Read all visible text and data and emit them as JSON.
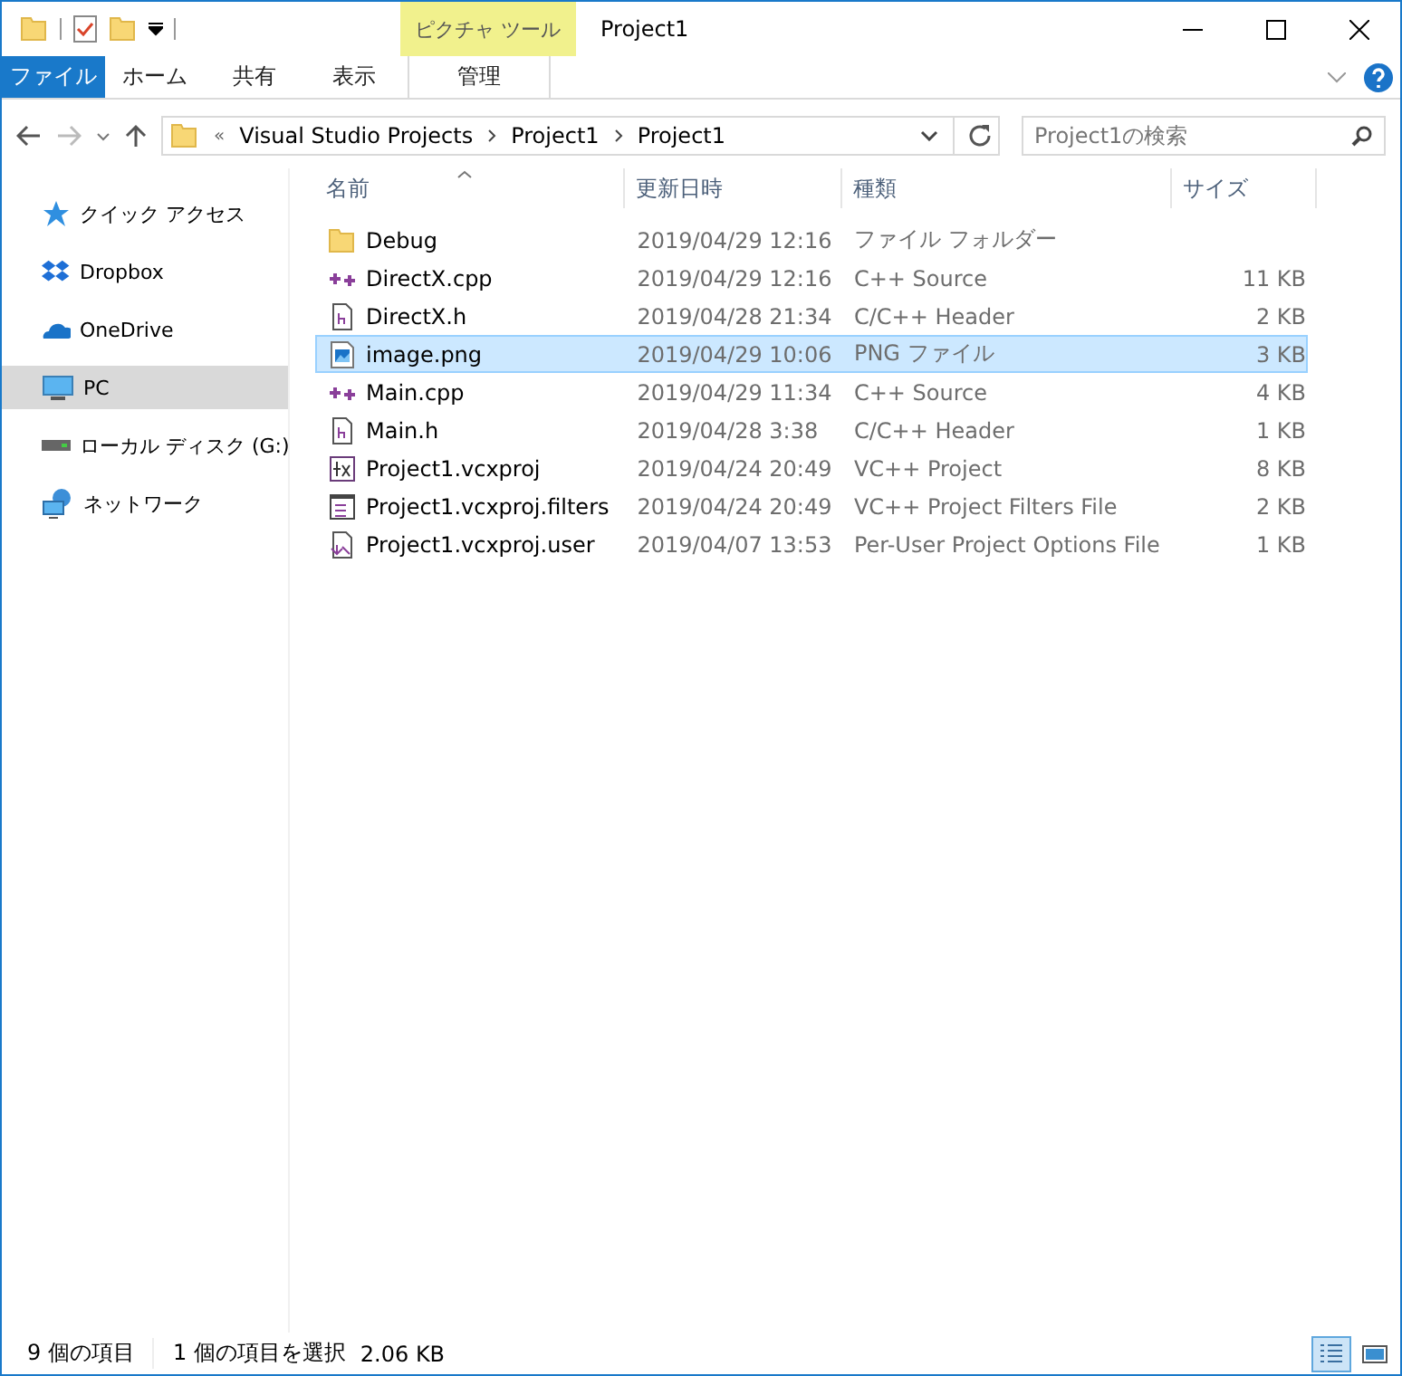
{
  "window": {
    "title": "Project1"
  },
  "context_group": {
    "title": "ピクチャ ツール",
    "tab": "管理"
  },
  "ribbon": {
    "file_tab": "ファイル",
    "tabs": [
      "ホーム",
      "共有",
      "表示"
    ]
  },
  "address": {
    "overflow": "«",
    "path": [
      "Visual Studio Projects",
      "Project1",
      "Project1"
    ]
  },
  "search": {
    "placeholder": "Project1の検索"
  },
  "sidebar": {
    "items": [
      {
        "label": "クイック アクセス",
        "kind": "quick",
        "selected": false
      },
      {
        "label": "Dropbox",
        "kind": "dropbox",
        "selected": false
      },
      {
        "label": "OneDrive",
        "kind": "onedrive",
        "selected": false
      },
      {
        "label": "PC",
        "kind": "pc",
        "selected": true
      },
      {
        "label": "ローカル ディスク (G:)",
        "kind": "drive",
        "selected": false
      },
      {
        "label": "ネットワーク",
        "kind": "network",
        "selected": false
      }
    ]
  },
  "table": {
    "columns": [
      {
        "label": "名前",
        "sorted": true
      },
      {
        "label": "更新日時",
        "sorted": false
      },
      {
        "label": "種類",
        "sorted": false
      },
      {
        "label": "サイズ",
        "sorted": false
      }
    ],
    "rows": [
      {
        "name": "Debug",
        "date": "2019/04/29 12:16",
        "type": "ファイル フォルダー",
        "kind": "folder",
        "selected": false
      },
      {
        "name": "DirectX.cpp",
        "date": "2019/04/29 12:16",
        "type": "C++ Source",
        "size": "11 KB",
        "kind": "cpp",
        "selected": false
      },
      {
        "name": "DirectX.h",
        "date": "2019/04/28 21:34",
        "type": "C/C++ Header",
        "size": "2 KB",
        "kind": "header",
        "selected": false
      },
      {
        "name": "image.png",
        "date": "2019/04/29 10:06",
        "type": "PNG ファイル",
        "size": "3 KB",
        "kind": "image",
        "selected": true
      },
      {
        "name": "Main.cpp",
        "date": "2019/04/29 11:34",
        "type": "C++ Source",
        "size": "4 KB",
        "kind": "cpp",
        "selected": false
      },
      {
        "name": "Main.h",
        "date": "2019/04/28 3:38",
        "type": "C/C++ Header",
        "size": "1 KB",
        "kind": "header",
        "selected": false
      },
      {
        "name": "Project1.vcxproj",
        "date": "2019/04/24 20:49",
        "type": "VC++ Project",
        "size": "8 KB",
        "kind": "project",
        "selected": false
      },
      {
        "name": "Project1.vcxproj.filters",
        "date": "2019/04/24 20:49",
        "type": "VC++ Project Filters File",
        "size": "2 KB",
        "kind": "filters",
        "selected": false
      },
      {
        "name": "Project1.vcxproj.user",
        "date": "2019/04/07 13:53",
        "type": "Per-User Project Options File",
        "size": "1 KB",
        "kind": "user",
        "selected": false
      }
    ]
  },
  "status_bar": {
    "count": "9 個の項目",
    "selection": "1 個の項目を選択",
    "selection_size": "2.06 KB",
    "views": [
      {
        "kind": "details",
        "selected": true
      },
      {
        "kind": "tiles",
        "selected": false
      }
    ]
  }
}
